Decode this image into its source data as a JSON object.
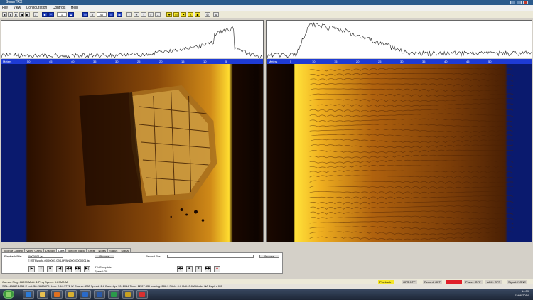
{
  "window": {
    "title": "SonarTRX",
    "buttons": [
      "_",
      "□",
      "x"
    ]
  },
  "menu": [
    "File",
    "View",
    "Configuration",
    "Controls",
    "Help"
  ],
  "toolbar": {
    "field_a": "1",
    "field_b": "40"
  },
  "left_panel": {
    "scale_unit": "Meters",
    "ticks": [
      "50",
      "45",
      "40",
      "35",
      "30",
      "25",
      "20",
      "15",
      "10",
      "5"
    ]
  },
  "right_panel": {
    "scale_unit": "Meters",
    "ticks": [
      "5",
      "10",
      "15",
      "20",
      "25",
      "30",
      "35",
      "40",
      "45",
      "50"
    ]
  },
  "tabs": [
    "Toolbar Control",
    "Video Gains",
    "Display",
    "Data",
    "Bottom Track",
    "Grids",
    "Notes",
    "Status",
    "Signal"
  ],
  "active_tab": "Data",
  "playback": {
    "label": "Playback File:",
    "filename": "0000001.jsf",
    "path": "E:\\STRworkl-0000001.094-HVAN000-0000001.jsf",
    "button": "Browse",
    "complete": "0% Complete",
    "speed": "Speed: 20"
  },
  "record": {
    "label": "Record File:",
    "value": "",
    "button": "Browse"
  },
  "infobar": "SOL: 48887.1055 E    Lat: 38.26.8887 N    Lon: 2.44.7772 W    Course: 280    Speed: 2.6    Date: Apr 10, 2014    Time: 12:07:33    Heading: 286.9    Pitch: 0.0    Roll: 0.0    Altitude: NA    Depth: 0.0",
  "status_tags": [
    {
      "text": "Playback",
      "bg": "#f5e62a"
    },
    {
      "text": "GPS OFF",
      "bg": "#d4d0c8"
    },
    {
      "text": "Record: OFF",
      "bg": "#d4d0c8"
    },
    {
      "text": "",
      "bg": "#e0202a"
    },
    {
      "text": "Power: OFF",
      "bg": "#d4d0c8"
    },
    {
      "text": "AGC: OFF",
      "bg": "#d4d0c8"
    },
    {
      "text": "Signal: NONE",
      "bg": "#d4d0c8"
    }
  ],
  "ping_info": "Current Ping: 86099    Multi: 1    Ping Speed: 9.29M NM",
  "clock": {
    "time": "14:09",
    "date": "02/06/2014"
  },
  "colors": {
    "scale_bar": "#1e3bd4",
    "sonar_bright": "#ffe23a",
    "sonar_dark": "#2a0f00"
  }
}
